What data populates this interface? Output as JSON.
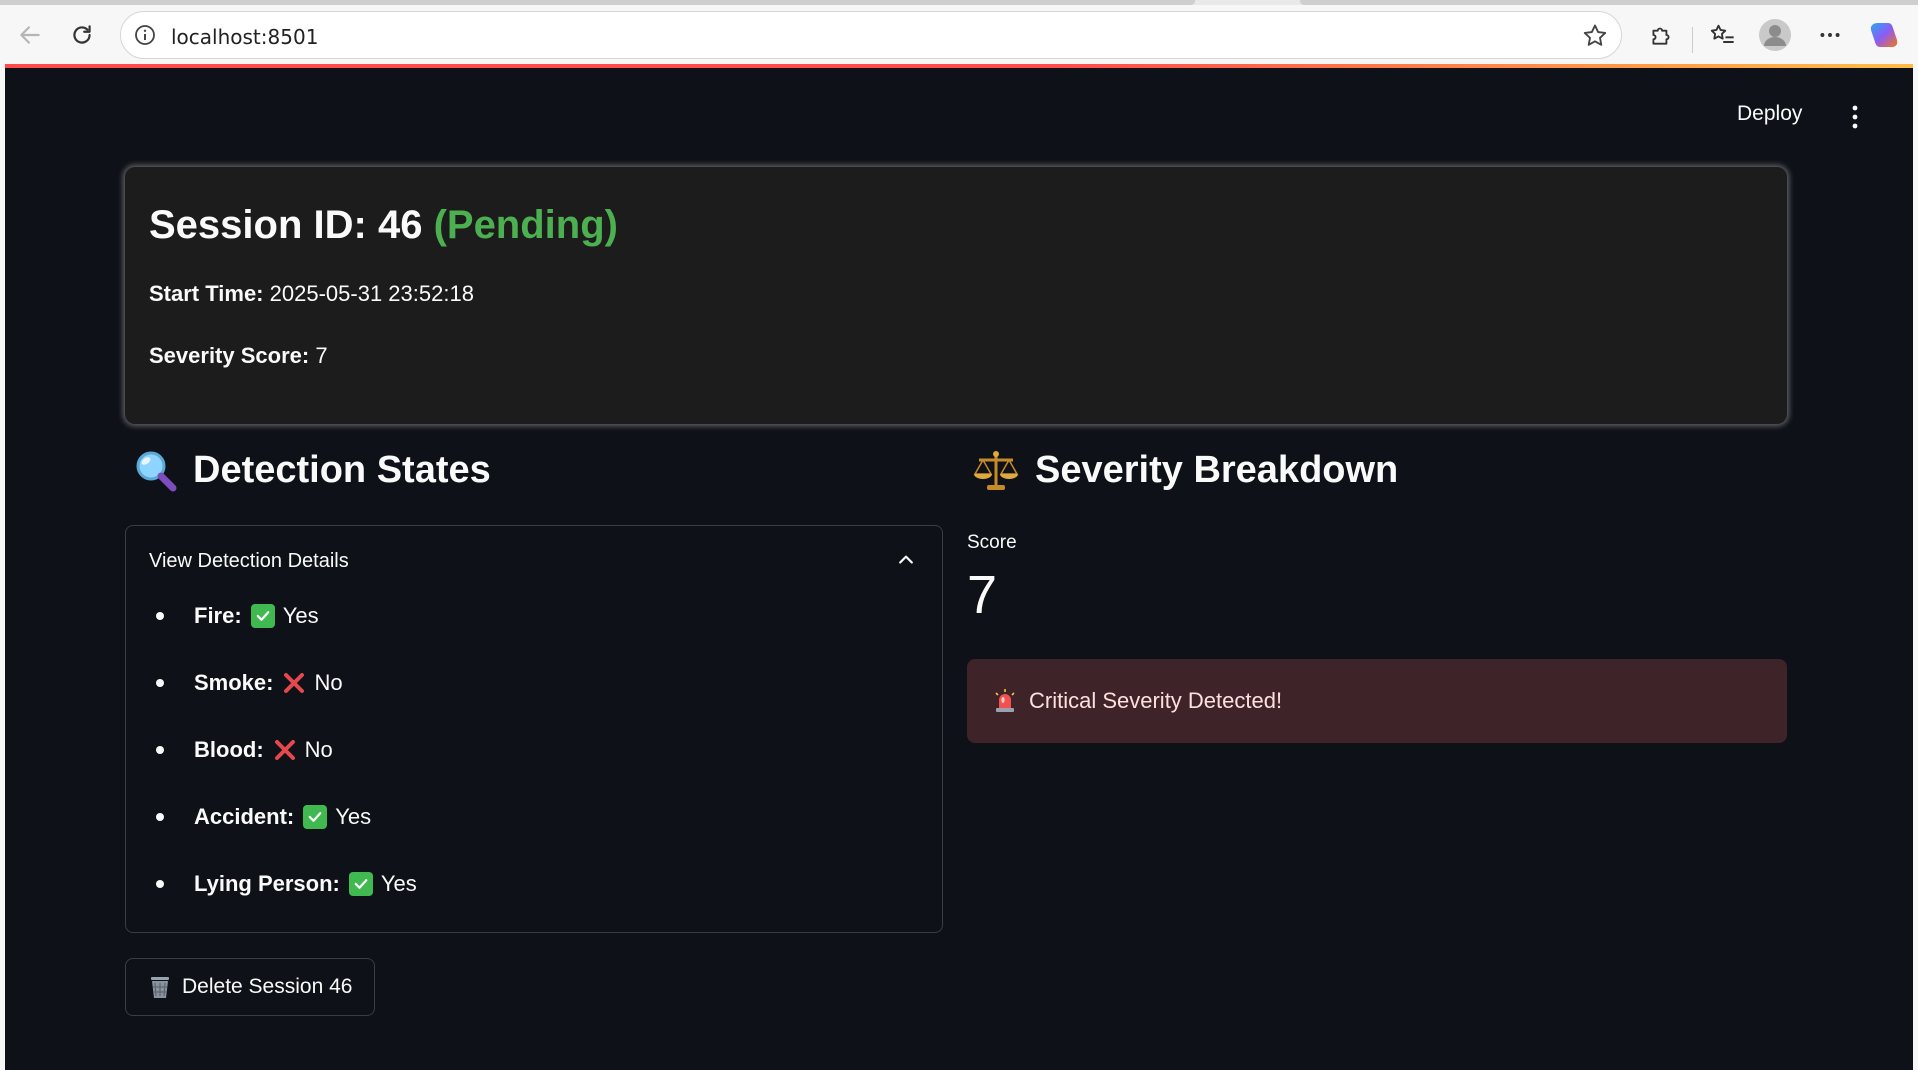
{
  "browser": {
    "url": "localhost:8501"
  },
  "app": {
    "deploy_label": "Deploy"
  },
  "session": {
    "title_prefix": "Session ID: 46",
    "status": "(Pending)",
    "start_time_label": "Start Time:",
    "start_time_value": "2025-05-31 23:52:18",
    "severity_label": "Severity Score:",
    "severity_value": "7"
  },
  "detection": {
    "heading": "Detection States",
    "heading_icon": "magnifier-icon",
    "expander_label": "View Detection Details",
    "items": [
      {
        "label": "Fire:",
        "state": "Yes",
        "icon": "check-icon"
      },
      {
        "label": "Smoke:",
        "state": "No",
        "icon": "cross-icon"
      },
      {
        "label": "Blood:",
        "state": "No",
        "icon": "cross-icon"
      },
      {
        "label": "Accident:",
        "state": "Yes",
        "icon": "check-icon"
      },
      {
        "label": "Lying Person:",
        "state": "Yes",
        "icon": "check-icon"
      }
    ],
    "delete_label": "Delete Session 46"
  },
  "severity": {
    "heading": "Severity Breakdown",
    "heading_icon": "scales-icon",
    "metric_label": "Score",
    "metric_value": "7",
    "alert_text": "Critical Severity Detected!"
  },
  "colors": {
    "app_bg": "#0e1117",
    "card_bg": "#1c1c1c",
    "pending": "#4caf50",
    "alert_bg": "#3e2428",
    "check": "#3fb950",
    "cross": "#e5484d"
  }
}
